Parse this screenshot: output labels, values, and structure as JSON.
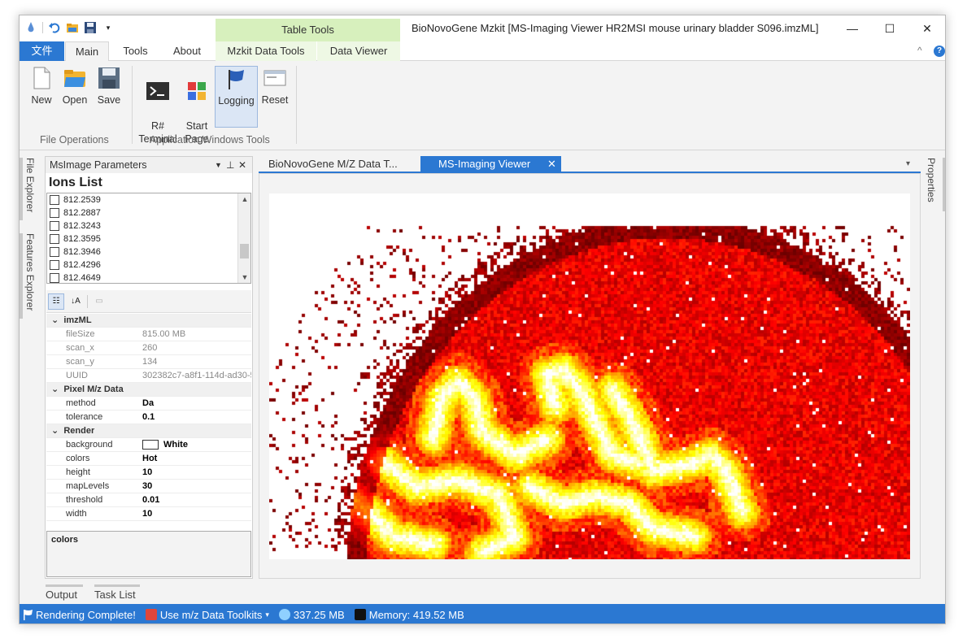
{
  "window": {
    "title": "BioNovoGene Mzkit [MS-Imaging Viewer HR2MSI mouse urinary bladder S096.imzML]",
    "contextual_header": "Table Tools",
    "minimize": "—",
    "maximize": "☐",
    "close": "✕"
  },
  "ribbon": {
    "tabs": [
      {
        "label": "文件"
      },
      {
        "label": "Main"
      },
      {
        "label": "Tools"
      },
      {
        "label": "About"
      },
      {
        "label": "Mzkit Data Tools"
      },
      {
        "label": "Data Viewer"
      }
    ],
    "collapse_glyph": "^",
    "help_glyph": "?",
    "buttons": [
      {
        "label": "New"
      },
      {
        "label": "Open"
      },
      {
        "label": "Save"
      },
      {
        "label": "R#\nTerminal"
      },
      {
        "label": "Start\nPage"
      },
      {
        "label": "Logging"
      },
      {
        "label": "Reset"
      }
    ],
    "groups": [
      "File Operations",
      "Application Windows Tools"
    ]
  },
  "left_dock": {
    "tabs": [
      "File Explorer",
      "Features Explorer"
    ]
  },
  "right_dock": {
    "tabs": [
      "Properties"
    ]
  },
  "panel": {
    "title": "MsImage Parameters",
    "ions_title": "Ions List",
    "ions": [
      "812.2539",
      "812.2887",
      "812.3243",
      "812.3595",
      "812.3946",
      "812.4296",
      "812.4649"
    ],
    "properties": {
      "imzml": {
        "category": "imzML",
        "rows": [
          {
            "key": "fileSize",
            "value": "815.00 MB"
          },
          {
            "key": "scan_x",
            "value": "260"
          },
          {
            "key": "scan_y",
            "value": "134"
          },
          {
            "key": "UUID",
            "value": "302382c7-a8f1-114d-ad30-5"
          }
        ]
      },
      "pixel": {
        "category": "Pixel M/z Data",
        "rows": [
          {
            "key": "method",
            "value": "Da"
          },
          {
            "key": "tolerance",
            "value": "0.1"
          }
        ]
      },
      "render": {
        "category": "Render",
        "rows": [
          {
            "key": "background",
            "value": "White"
          },
          {
            "key": "colors",
            "value": "Hot"
          },
          {
            "key": "height",
            "value": "10"
          },
          {
            "key": "mapLevels",
            "value": "30"
          },
          {
            "key": "threshold",
            "value": "0.01"
          },
          {
            "key": "width",
            "value": "10"
          }
        ]
      }
    },
    "description_title": "colors"
  },
  "documents": {
    "tabs": [
      {
        "label": "BioNovoGene M/Z Data T..."
      },
      {
        "label": "MS-Imaging Viewer"
      }
    ],
    "close_glyph": "✕",
    "overflow_glyph": "▾",
    "image_colormap": "Hot"
  },
  "bottom_tabs": [
    "Output",
    "Task List"
  ],
  "status": {
    "message": "Rendering Complete!",
    "toolkit": "Use m/z Data Toolkits",
    "size": "337.25 MB",
    "memory": "Memory: 419.52 MB"
  },
  "colors": {
    "accent": "#2b78d2",
    "contextual": "#d7f0bd",
    "status_bar": "#2b78d2"
  }
}
